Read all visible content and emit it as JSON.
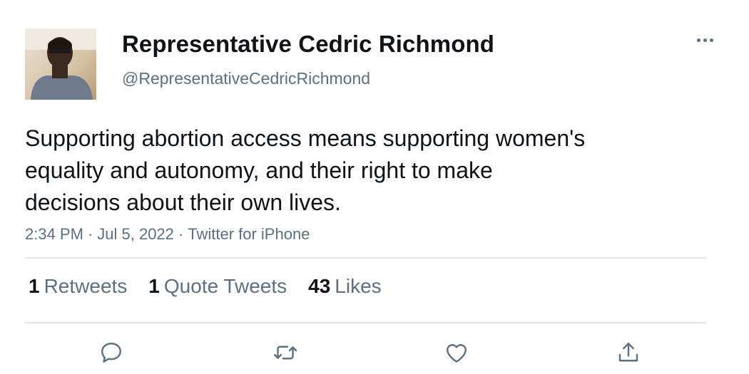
{
  "author": {
    "name": "Representative Cedric Richmond",
    "handle": "@RepresentativeCedricRichmond",
    "avatar_icon": "profile-photo"
  },
  "tweet": {
    "text": "Supporting abortion access means supporting women's\nequality and autonomy, and their right to make\ndecisions about their own lives.",
    "time": "2:34 PM",
    "date": "Jul 5, 2022",
    "source": "Twitter for iPhone",
    "separator": "·"
  },
  "stats": {
    "retweets": {
      "count": "1",
      "label": "Retweets"
    },
    "quotes": {
      "count": "1",
      "label": "Quote Tweets"
    },
    "likes": {
      "count": "43",
      "label": "Likes"
    }
  },
  "actions": [
    "reply-icon",
    "retweet-icon",
    "like-icon",
    "share-icon"
  ],
  "colors": {
    "text": "#0f1419",
    "secondary": "#5b7083",
    "divider": "#e1e8ed"
  }
}
